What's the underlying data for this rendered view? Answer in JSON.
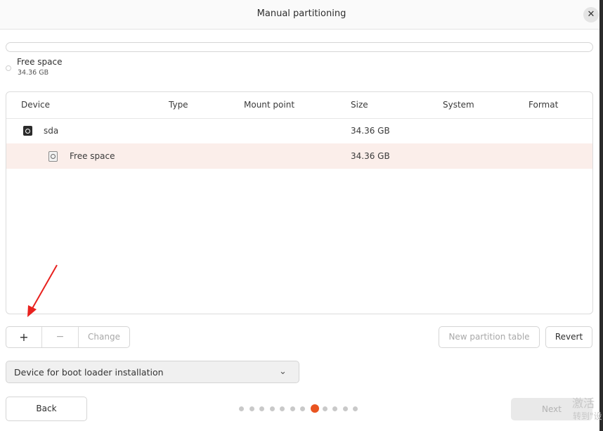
{
  "window": {
    "title": "Manual partitioning",
    "close_symbol": "✕"
  },
  "usage_legend": {
    "name": "Free space",
    "size": "34.36 GB"
  },
  "table": {
    "columns": [
      "Device",
      "Type",
      "Mount point",
      "Size",
      "System",
      "Format"
    ],
    "rows": [
      {
        "device": "sda",
        "type": "",
        "mount": "",
        "size": "34.36 GB",
        "system": "",
        "format": "",
        "icon": "disk-icon",
        "selected": false
      },
      {
        "device": "Free space",
        "type": "",
        "mount": "",
        "size": "34.36 GB",
        "system": "",
        "format": "",
        "icon": "disk-icon",
        "selected": true
      }
    ]
  },
  "toolbar": {
    "add_label": "+",
    "remove_label": "−",
    "change_label": "Change",
    "new_table_label": "New partition table",
    "revert_label": "Revert"
  },
  "bootloader": {
    "label": "Device for boot loader installation",
    "chevron": "⌄"
  },
  "nav": {
    "back_label": "Back",
    "next_label": "Next",
    "steps_total": 12,
    "current_step": 8
  },
  "watermark": {
    "line1": "激活",
    "line2": "转到\"设"
  },
  "colors": {
    "accent": "#e95420",
    "selected_row": "#fbeeea",
    "arrow": "#e8211e"
  }
}
